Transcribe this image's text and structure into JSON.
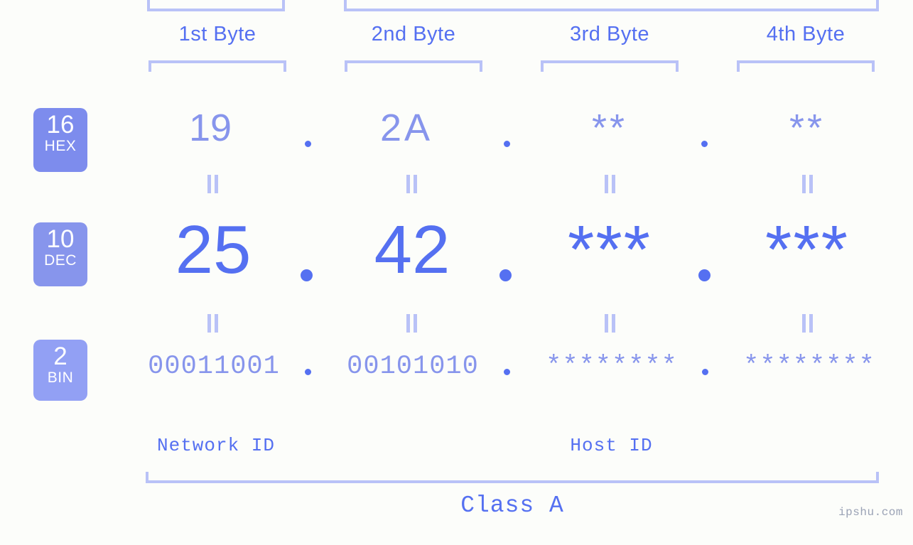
{
  "background_color": "#fcfdfa",
  "accent_color": "#5570f1",
  "accent_light": "#8795ec",
  "accent_pale": "#b9c2f7",
  "byte_headers": [
    {
      "label": "1st Byte"
    },
    {
      "label": "2nd Byte"
    },
    {
      "label": "3rd Byte"
    },
    {
      "label": "4th Byte"
    }
  ],
  "rows": [
    {
      "key": "hex",
      "badge_number": "16",
      "badge_name": "HEX",
      "values": [
        "19",
        "2A",
        "**",
        "**"
      ],
      "separator": "."
    },
    {
      "key": "dec",
      "badge_number": "10",
      "badge_name": "DEC",
      "values": [
        "25",
        "42",
        "***",
        "***"
      ],
      "separator": "."
    },
    {
      "key": "bin",
      "badge_number": "2",
      "badge_name": "BIN",
      "values": [
        "00011001",
        "00101010",
        "********",
        "********"
      ],
      "separator": "."
    }
  ],
  "id_sections": [
    {
      "label": "Network ID"
    },
    {
      "label": "Host ID"
    }
  ],
  "class": {
    "label": "Class A"
  },
  "watermark": {
    "text": "ipshu.com"
  }
}
